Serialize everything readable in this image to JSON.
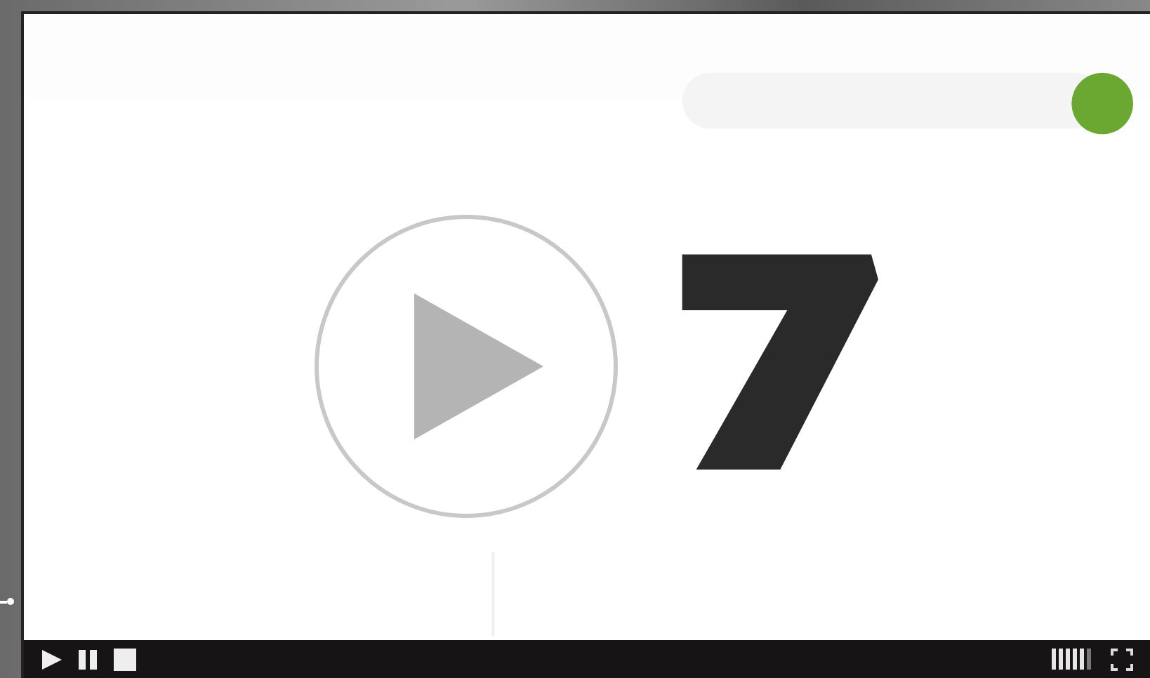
{
  "player": {
    "volume": {
      "level": 0.83
    }
  }
}
